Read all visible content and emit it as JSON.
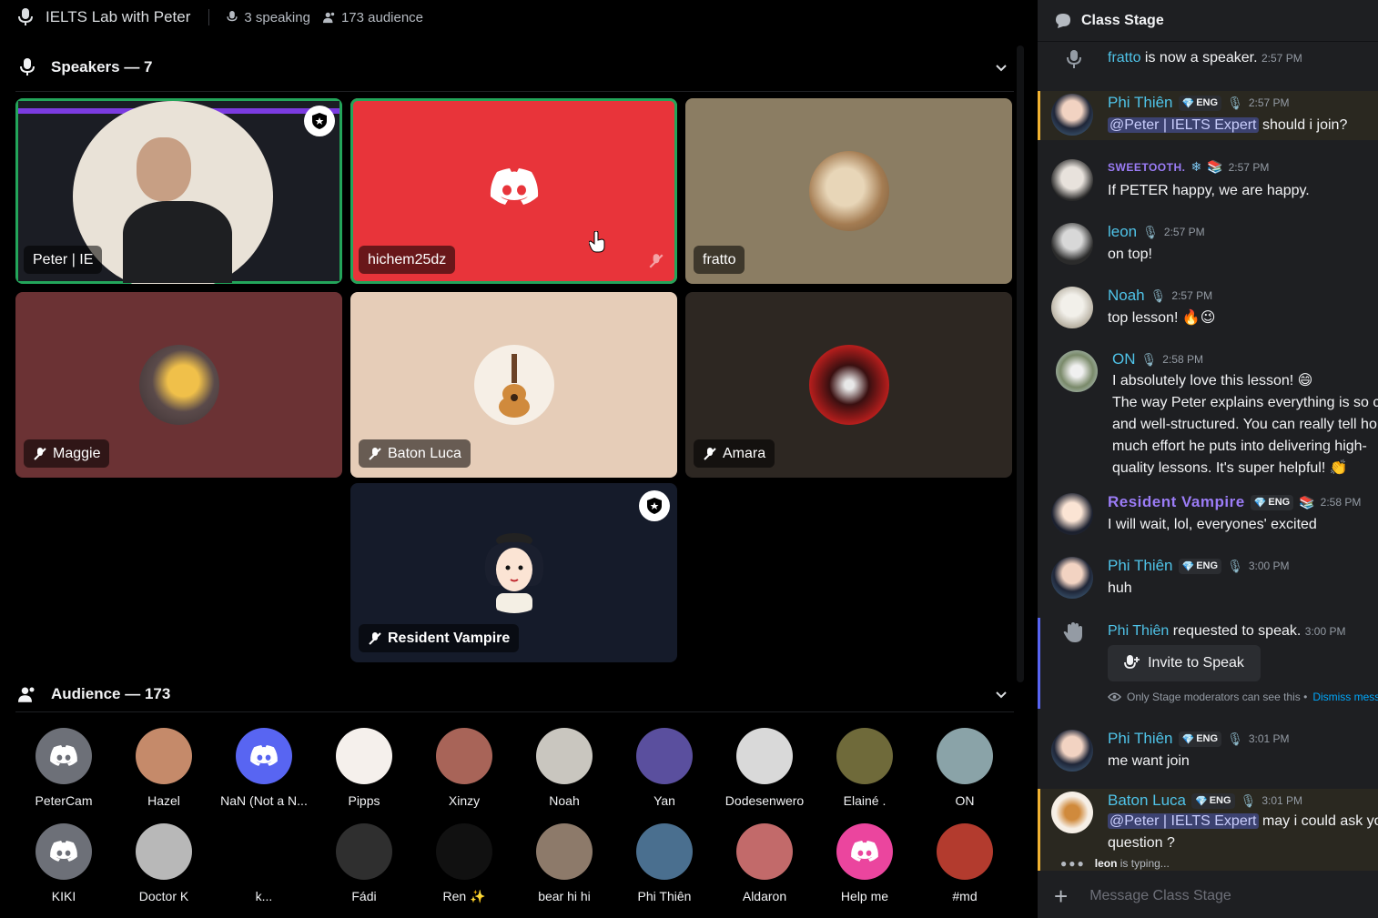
{
  "stage": {
    "title": "IELTS Lab with Peter",
    "speaking": "3 speaking",
    "audience": "173 audience"
  },
  "speakers_header": "Speakers — 7",
  "speakers": [
    {
      "name": "Peter | IE",
      "bg": "#3a3630",
      "speaking": true,
      "mod": true
    },
    {
      "name": "hichem25dz",
      "bg": "#e8343a",
      "speaking": true,
      "mod": false
    },
    {
      "name": "fratto",
      "bg": "#8b7d63",
      "speaking": false,
      "mod": false
    },
    {
      "name": "Maggie",
      "bg": "#6b3234",
      "speaking": false,
      "mod": false
    },
    {
      "name": "Baton Luca",
      "bg": "#e6cdb8",
      "speaking": false,
      "mod": false
    },
    {
      "name": "Amara",
      "bg": "#2d2722",
      "speaking": false,
      "mod": false
    },
    {
      "name": "Resident Vampire",
      "bg": "#151b2a",
      "speaking": false,
      "mod": true
    }
  ],
  "audience_header": "Audience — 173",
  "audience": [
    {
      "name": "PeterCam",
      "color": "#6d7078"
    },
    {
      "name": "Hazel",
      "color": "#c58a6a"
    },
    {
      "name": "NaN (Not a N...",
      "color": "#5865f2"
    },
    {
      "name": "Pipps",
      "color": "#f5f0ec"
    },
    {
      "name": "Xinzy",
      "color": "#a86458"
    },
    {
      "name": "Noah",
      "color": "#c9c6bf"
    },
    {
      "name": "Yan",
      "color": "#5a4f9e"
    },
    {
      "name": "Dodesenwero",
      "color": "#d9d9d9"
    },
    {
      "name": "Elainé .",
      "color": "#6f6a3a"
    },
    {
      "name": "ON",
      "color": "#8aa3a8"
    },
    {
      "name": "KIKI",
      "color": "#6d7078"
    },
    {
      "name": "Doctor K",
      "color": "#b8b8b8"
    },
    {
      "name": "k...",
      "color": "#000000"
    },
    {
      "name": "Fádi",
      "color": "#2f2f2f"
    },
    {
      "name": "Ren ✨",
      "color": "#111111"
    },
    {
      "name": "bear hi hi",
      "color": "#8d7a6a"
    },
    {
      "name": "Phi Thiên",
      "color": "#4a6f8f"
    },
    {
      "name": "Aldaron",
      "color": "#c26a6a"
    },
    {
      "name": "Help me",
      "color": "#eb459e"
    },
    {
      "name": "#md",
      "color": "#b33b2e"
    }
  ],
  "chat": {
    "title": "Class Stage",
    "system1": {
      "name": "fratto",
      "text": "is now a speaker.",
      "time": "2:57 PM"
    },
    "messages": [
      {
        "name": "Phi Thiên",
        "tag": "ENG",
        "time": "2:57 PM",
        "mention": "@Peter | IELTS Expert",
        "text": "should i join?"
      },
      {
        "name": "SWEETOOTH.",
        "tag": "",
        "time": "2:57 PM",
        "mention": "",
        "text": "If PETER happy, we are happy."
      },
      {
        "name": "leon",
        "tag": "",
        "time": "2:57 PM",
        "mention": "",
        "text": "on top!"
      },
      {
        "name": "Noah",
        "tag": "",
        "time": "2:57 PM",
        "mention": "",
        "text": "top lesson! 🔥😉"
      },
      {
        "name": "ON",
        "tag": "",
        "time": "2:58 PM",
        "mention": "",
        "text": "I absolutely love this lesson! 😄"
      },
      {
        "name": "Resident Vampire",
        "tag": "ENG",
        "time": "2:58 PM",
        "mention": "",
        "text": "I will wait, lol, everyones' excited"
      },
      {
        "name": "Phi Thiên",
        "tag": "ENG",
        "time": "3:00 PM",
        "mention": "",
        "text": "huh"
      },
      {
        "name": "Phi Thiên",
        "tag": "ENG",
        "time": "3:01 PM",
        "mention": "",
        "text": "me want join"
      },
      {
        "name": "Baton Luca",
        "tag": "ENG",
        "time": "3:01 PM",
        "mention": "@Peter | IELTS Expert",
        "text": "may i could ask yo"
      }
    ],
    "on_extra": [
      "The way Peter explains everything is so cle",
      "and well-structured. You can really tell ho",
      "much effort he puts into delivering high-",
      "quality lessons. It's super helpful! 👏"
    ],
    "baton_extra": "question ?",
    "request": {
      "name": "Phi Thiên",
      "text": "requested to speak.",
      "time": "3:00 PM",
      "button": "Invite to Speak",
      "notice": "Only Stage moderators can see this •",
      "dismiss": "Dismiss mess"
    },
    "typing_name": "leon",
    "typing_text": "is typing...",
    "composer_placeholder": "Message Class Stage"
  },
  "colors": {
    "speaking_ring": "#23a55a",
    "discord_blurple": "#5865f2",
    "name_teal": "#4fc3e8",
    "name_purple": "#9b7cf6",
    "mention_bg": "#3c4270"
  }
}
